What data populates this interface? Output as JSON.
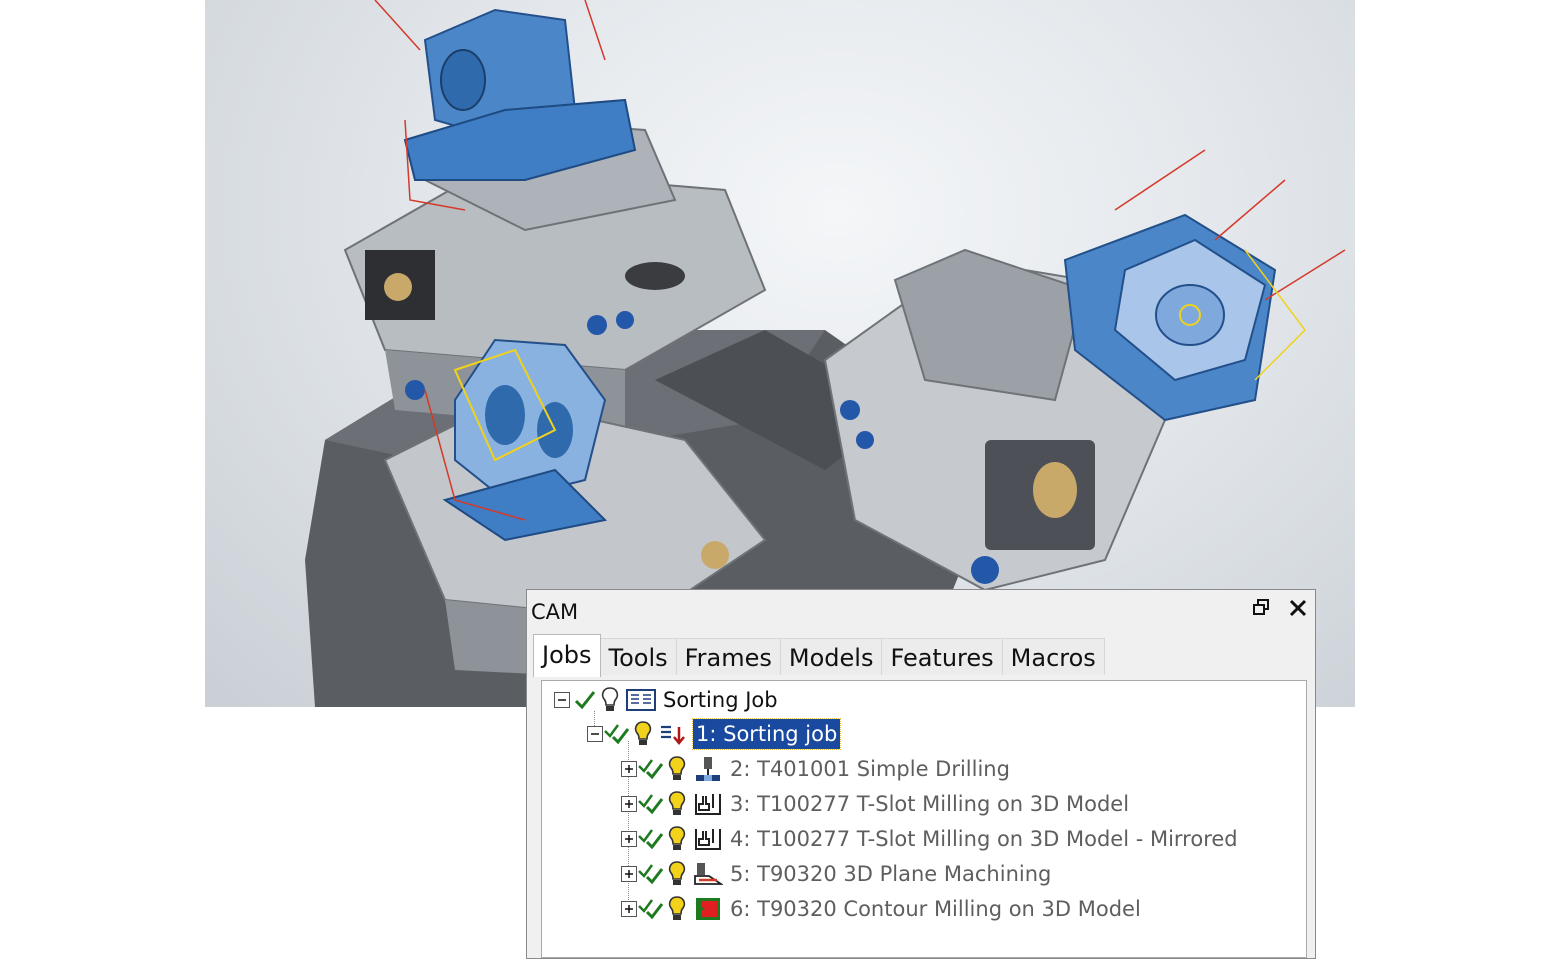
{
  "panel": {
    "title": "CAM",
    "restore_icon": "restore-window-icon",
    "close_icon": "close-icon"
  },
  "tabs": [
    {
      "label": "Jobs",
      "active": true
    },
    {
      "label": "Tools",
      "active": false
    },
    {
      "label": "Frames",
      "active": false
    },
    {
      "label": "Models",
      "active": false
    },
    {
      "label": "Features",
      "active": false
    },
    {
      "label": "Macros",
      "active": false
    }
  ],
  "tree": {
    "root": {
      "label": "Sorting Job",
      "icon": "job-list-icon"
    },
    "child": {
      "label": "1: Sorting job",
      "icon": "sort-icon",
      "selected": true
    },
    "items": [
      {
        "label": "2: T401001 Simple Drilling",
        "icon": "drilling-icon"
      },
      {
        "label": "3: T100277 T-Slot Milling on 3D Model",
        "icon": "t-slot-icon"
      },
      {
        "label": "4: T100277 T-Slot Milling on 3D Model - Mirrored",
        "icon": "t-slot-icon"
      },
      {
        "label": "5: T90320 3D Plane Machining",
        "icon": "plane-machining-icon"
      },
      {
        "label": "6: T90320 Contour Milling on 3D Model",
        "icon": "contour-milling-icon"
      }
    ]
  },
  "colors": {
    "selection": "#1a4aa0",
    "check": "#1e7a1e",
    "bulb": "#f2d21b",
    "part_blue": "#4a86c8",
    "fixture_gray": "#9aa0a6"
  }
}
